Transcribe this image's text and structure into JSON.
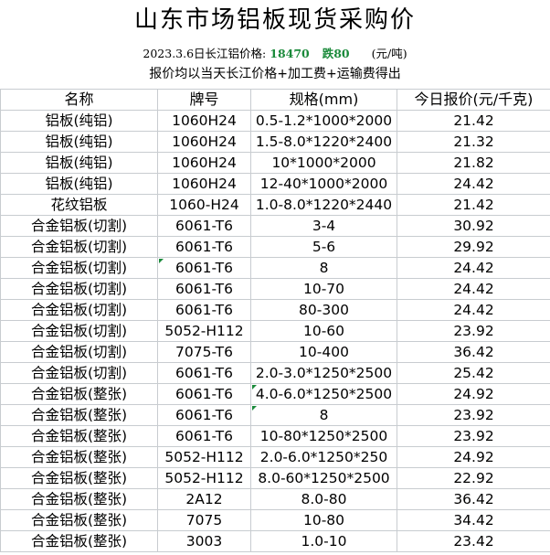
{
  "title": "山东市场铝板现货采购价",
  "subtitle": {
    "date_label": "2023.3.6日长江铝价格:",
    "price": "18470",
    "change": "跌80",
    "unit": "(元/吨)"
  },
  "note": "报价均以当天长江价格+加工费+运输费得出",
  "table": {
    "headers": [
      "名称",
      "牌号",
      "规格(mm)",
      "今日报价(元/千克)"
    ],
    "rows": [
      {
        "name": "铝板(纯铝)",
        "grade": "1060H24",
        "spec": "0.5-1.2*1000*2000",
        "price": "21.42"
      },
      {
        "name": "铝板(纯铝)",
        "grade": "1060H24",
        "spec": "1.5-8.0*1220*2400",
        "price": "21.32"
      },
      {
        "name": "铝板(纯铝)",
        "grade": "1060H24",
        "spec": "10*1000*2000",
        "price": "21.82"
      },
      {
        "name": "铝板(纯铝)",
        "grade": "1060H24",
        "spec": "12-40*1000*2000",
        "price": "24.42"
      },
      {
        "name": "花纹铝板",
        "grade": "1060-H24",
        "spec": "1.0-8.0*1220*2440",
        "price": "21.42"
      },
      {
        "name": "合金铝板(切割)",
        "grade": "6061-T6",
        "spec": "3-4",
        "price": "30.92"
      },
      {
        "name": "合金铝板(切割)",
        "grade": "6061-T6",
        "spec": "5-6",
        "price": "29.92"
      },
      {
        "name": "合金铝板(切割)",
        "grade": "6061-T6",
        "spec": "8",
        "price": "24.42"
      },
      {
        "name": "合金铝板(切割)",
        "grade": "6061-T6",
        "spec": "10-70",
        "price": "24.42"
      },
      {
        "name": "合金铝板(切割)",
        "grade": "6061-T6",
        "spec": "80-300",
        "price": "24.42"
      },
      {
        "name": "合金铝板(切割)",
        "grade": "5052-H112",
        "spec": "10-60",
        "price": "23.92"
      },
      {
        "name": "合金铝板(切割)",
        "grade": "7075-T6",
        "spec": "10-400",
        "price": "36.42"
      },
      {
        "name": "合金铝板(切割)",
        "grade": "6061-T6",
        "spec": "2.0-3.0*1250*2500",
        "price": "25.42"
      },
      {
        "name": "合金铝板(整张)",
        "grade": "6061-T6",
        "spec": "4.0-6.0*1250*2500",
        "price": "24.92"
      },
      {
        "name": "合金铝板(整张)",
        "grade": "6061-T6",
        "spec": "8",
        "price": "23.92"
      },
      {
        "name": "合金铝板(整张)",
        "grade": "6061-T6",
        "spec": "10-80*1250*2500",
        "price": "23.92"
      },
      {
        "name": "合金铝板(整张)",
        "grade": "5052-H112",
        "spec": "2.0-6.0*1250*250",
        "price": "24.92"
      },
      {
        "name": "合金铝板(整张)",
        "grade": "5052-H112",
        "spec": "8.0-60*1250*2500",
        "price": "22.92"
      },
      {
        "name": "合金铝板(整张)",
        "grade": "2A12",
        "spec": "8.0-80",
        "price": "36.42"
      },
      {
        "name": "合金铝板(整张)",
        "grade": "7075",
        "spec": "10-80",
        "price": "34.42"
      },
      {
        "name": "合金铝板(整张)",
        "grade": "3003",
        "spec": "1.0-10",
        "price": "23.42"
      }
    ]
  },
  "colors": {
    "price_green": "#1a8a3a",
    "grid_line": "#c8ccd0"
  }
}
